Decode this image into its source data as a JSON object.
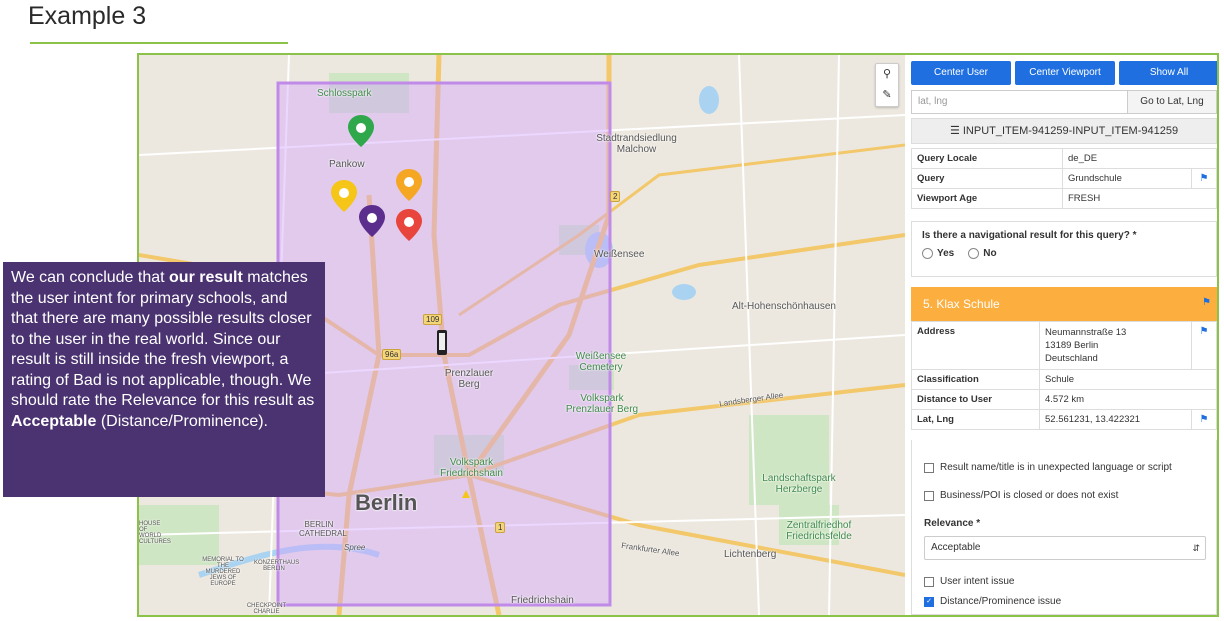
{
  "slide": {
    "title": "Example 3"
  },
  "map": {
    "labels": {
      "schlosspark": "Schlosspark",
      "pankow": "Pankow",
      "stadtrand": "Stadtrandsiedlung Malchow",
      "weissensee": "Weißensee",
      "alt_hohen": "Alt-Hohenschönhausen",
      "weissensee_cemetery": "Weißensee Cemetery",
      "prenzlauer_berg": "Prenzlauer Berg",
      "volkspark_pb": "Volkspark Prenzlauer Berg",
      "landsberger": "Landsberger Allee",
      "volkspark_fh": "Volkspark Friedrichshain",
      "berlin": "Berlin",
      "berlin_cathedral": "BERLIN CATHEDRAL",
      "landschaftspark": "Landschaftspark Herzberge",
      "zentralfriedhof": "Zentralfriedhof Friedrichsfelde",
      "frankfurter": "Frankfurter Allee",
      "lichtenberg": "Lichtenberg",
      "friedrichshain": "Friedrichshain",
      "memorial": "MEMORIAL TO THE MURDERED JEWS OF EUROPE",
      "konzerthaus": "KONZERTHAUS BERLIN",
      "checkpoint": "CHECKPOINT CHARLIE",
      "house_world": "HOUSE OF WORLD CULTURES",
      "spree": "Spree"
    },
    "shields": {
      "r2": "2",
      "r109": "109",
      "r96a": "96a",
      "r1": "1"
    },
    "pins": [
      {
        "color": "#2ea84a"
      },
      {
        "color": "#f5c518"
      },
      {
        "color": "#f5a623"
      },
      {
        "color": "#5b2d8c"
      },
      {
        "color": "#e8453c"
      }
    ],
    "controls": {
      "pin_icon": "map-pin-icon",
      "ruler_icon": "ruler-icon"
    }
  },
  "panel": {
    "buttons": {
      "center_user": "Center User",
      "center_viewport": "Center Viewport",
      "show_all": "Show All"
    },
    "latlng": {
      "placeholder": "lat, lng",
      "go": "Go to Lat, Lng"
    },
    "item_id": "INPUT_ITEM-941259-INPUT_ITEM-941259",
    "query": {
      "locale_k": "Query Locale",
      "locale_v": "de_DE",
      "query_k": "Query",
      "query_v": "Grundschule",
      "age_k": "Viewport Age",
      "age_v": "FRESH"
    },
    "nav_question": "Is there a navigational result for this query? *",
    "yes": "Yes",
    "no": "No",
    "result": {
      "title": "5. Klax Schule",
      "address_k": "Address",
      "address_1": "Neumannstraße 13",
      "address_2": "13189 Berlin",
      "address_3": "Deutschland",
      "class_k": "Classification",
      "class_v": "Schule",
      "dist_k": "Distance to User",
      "dist_v": "4.572 km",
      "latlng_k": "Lat, Lng",
      "latlng_v": "52.561231, 13.422321"
    },
    "checks": {
      "lang": "Result name/title is in unexpected language or script",
      "closed": "Business/POI is closed or does not exist",
      "relevance_label": "Relevance *",
      "relevance_value": "Acceptable",
      "intent": "User intent issue",
      "distance": "Distance/Prominence issue"
    },
    "colors": {
      "accent": "#1f6fe0",
      "result_header": "#fcae3f",
      "fresh": "#4caf50"
    }
  },
  "callout": {
    "p1": "We can conclude that ",
    "b1": "our result",
    "p2": " matches the user intent for primary schools, and that there are many possible results closer to the user in the real world. Since our result is still inside the fresh viewport, a rating of Bad is not applicable, though. We should rate the Relevance for this result as ",
    "b2": "Acceptable",
    "p3": " (Distance/Prominence).",
    "bg": "#4a3370"
  }
}
